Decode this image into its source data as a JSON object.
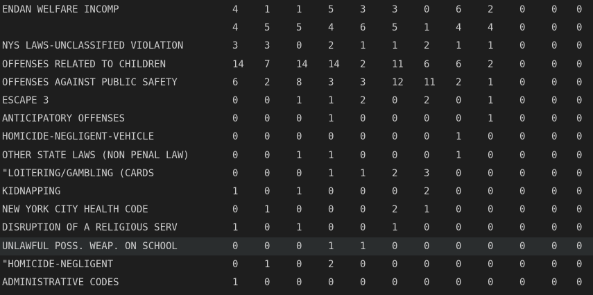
{
  "rows": [
    {
      "name": "ENDAN WELFARE INCOMP",
      "values": [
        "4",
        "1",
        "1",
        "5",
        "3",
        "3",
        "0",
        "6",
        "2",
        "0",
        "0",
        "0"
      ]
    },
    {
      "name": "",
      "values": [
        "4",
        "5",
        "5",
        "4",
        "6",
        "5",
        "1",
        "4",
        "4",
        "0",
        "0",
        "0"
      ]
    },
    {
      "name": "NYS LAWS-UNCLASSIFIED VIOLATION",
      "values": [
        "3",
        "3",
        "0",
        "2",
        "1",
        "1",
        "2",
        "1",
        "1",
        "0",
        "0",
        "0"
      ]
    },
    {
      "name": "OFFENSES RELATED TO CHILDREN",
      "values": [
        "14",
        "7",
        "14",
        "14",
        "2",
        "11",
        "6",
        "6",
        "2",
        "0",
        "0",
        "0"
      ]
    },
    {
      "name": "OFFENSES AGAINST PUBLIC SAFETY",
      "values": [
        "6",
        "2",
        "8",
        "3",
        "3",
        "12",
        "11",
        "2",
        "1",
        "0",
        "0",
        "0"
      ]
    },
    {
      "name": "ESCAPE 3",
      "values": [
        "0",
        "0",
        "1",
        "1",
        "2",
        "0",
        "2",
        "0",
        "1",
        "0",
        "0",
        "0"
      ]
    },
    {
      "name": "ANTICIPATORY OFFENSES",
      "values": [
        "0",
        "0",
        "0",
        "1",
        "0",
        "0",
        "0",
        "0",
        "1",
        "0",
        "0",
        "0"
      ]
    },
    {
      "name": "HOMICIDE-NEGLIGENT-VEHICLE",
      "values": [
        "0",
        "0",
        "0",
        "0",
        "0",
        "0",
        "0",
        "1",
        "0",
        "0",
        "0",
        "0"
      ]
    },
    {
      "name": "OTHER STATE LAWS (NON PENAL LAW)",
      "values": [
        "0",
        "0",
        "1",
        "1",
        "0",
        "0",
        "0",
        "1",
        "0",
        "0",
        "0",
        "0"
      ]
    },
    {
      "name": "\"LOITERING/GAMBLING (CARDS",
      "values": [
        "0",
        "0",
        "0",
        "1",
        "1",
        "2",
        "3",
        "0",
        "0",
        "0",
        "0",
        "0"
      ]
    },
    {
      "name": "KIDNAPPING",
      "values": [
        "1",
        "0",
        "1",
        "0",
        "0",
        "0",
        "2",
        "0",
        "0",
        "0",
        "0",
        "0"
      ]
    },
    {
      "name": "NEW YORK CITY HEALTH CODE",
      "values": [
        "0",
        "1",
        "0",
        "0",
        "0",
        "2",
        "1",
        "0",
        "0",
        "0",
        "0",
        "0"
      ]
    },
    {
      "name": "DISRUPTION OF A RELIGIOUS SERV",
      "values": [
        "1",
        "0",
        "1",
        "0",
        "0",
        "1",
        "0",
        "0",
        "0",
        "0",
        "0",
        "0"
      ]
    },
    {
      "name": "UNLAWFUL POSS. WEAP. ON SCHOOL",
      "values": [
        "0",
        "0",
        "0",
        "1",
        "1",
        "0",
        "0",
        "0",
        "0",
        "0",
        "0",
        "0"
      ]
    },
    {
      "name": "\"HOMICIDE-NEGLIGENT",
      "values": [
        "0",
        "1",
        "0",
        "2",
        "0",
        "0",
        "0",
        "0",
        "0",
        "0",
        "0",
        "0"
      ]
    },
    {
      "name": "ADMINISTRATIVE CODES",
      "values": [
        "1",
        "0",
        "0",
        "0",
        "0",
        "0",
        "0",
        "0",
        "0",
        "0",
        "0",
        "0"
      ]
    }
  ],
  "highlighted_row": 13,
  "colors": {
    "background": "#1e1e1e",
    "text": "#cccccc",
    "line_highlight": "#2a2d2e"
  }
}
